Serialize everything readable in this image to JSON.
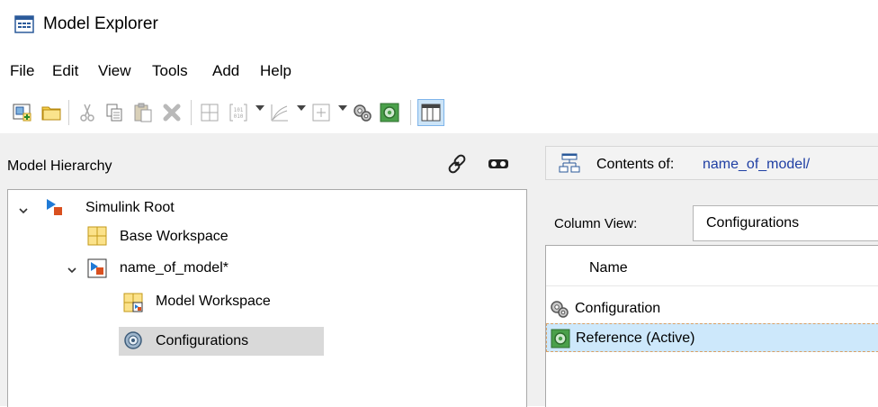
{
  "window": {
    "title": "Model Explorer",
    "app_icon": "model-explorer-icon"
  },
  "menu": {
    "items": [
      "File",
      "Edit",
      "View",
      "Tools",
      "Add",
      "Help"
    ]
  },
  "toolbar": {
    "buttons": [
      "new-model-icon",
      "open-folder-icon",
      "cut-icon",
      "copy-icon",
      "paste-icon",
      "delete-icon",
      "add-matlab-variable-icon",
      "add-simulink-data-icon",
      "add-signal-icon",
      "add-parameter-icon",
      "config-set-icon",
      "config-reference-icon",
      "dialog-view-icon"
    ]
  },
  "left_pane": {
    "header": "Model Hierarchy",
    "buttons": [
      "link-icon",
      "show-only-icon"
    ],
    "tree": [
      {
        "label": "Simulink Root",
        "icon": "simulink-root-icon",
        "expanded": true
      },
      {
        "label": "Base Workspace",
        "icon": "workspace-icon"
      },
      {
        "label": "name_of_model*",
        "icon": "model-icon",
        "expanded": true
      },
      {
        "label": "Model Workspace",
        "icon": "model-workspace-icon"
      },
      {
        "label": "Configurations",
        "icon": "configurations-icon",
        "selected": true
      }
    ]
  },
  "right_pane": {
    "contents_label": "Contents of:",
    "contents_path": "name_of_model/",
    "column_view_label": "Column View:",
    "column_view_value": "Configurations",
    "list_header": "Name",
    "rows": [
      {
        "label": "Configuration",
        "icon": "configuration-set-icon"
      },
      {
        "label": "Reference (Active)",
        "icon": "configuration-reference-icon",
        "selected": true
      }
    ]
  },
  "colors": {
    "selection": "#cde8fb",
    "tree_selection": "#d9d9d9",
    "path_link": "#1f3fa3",
    "pane_bg": "#f0f0f0"
  }
}
